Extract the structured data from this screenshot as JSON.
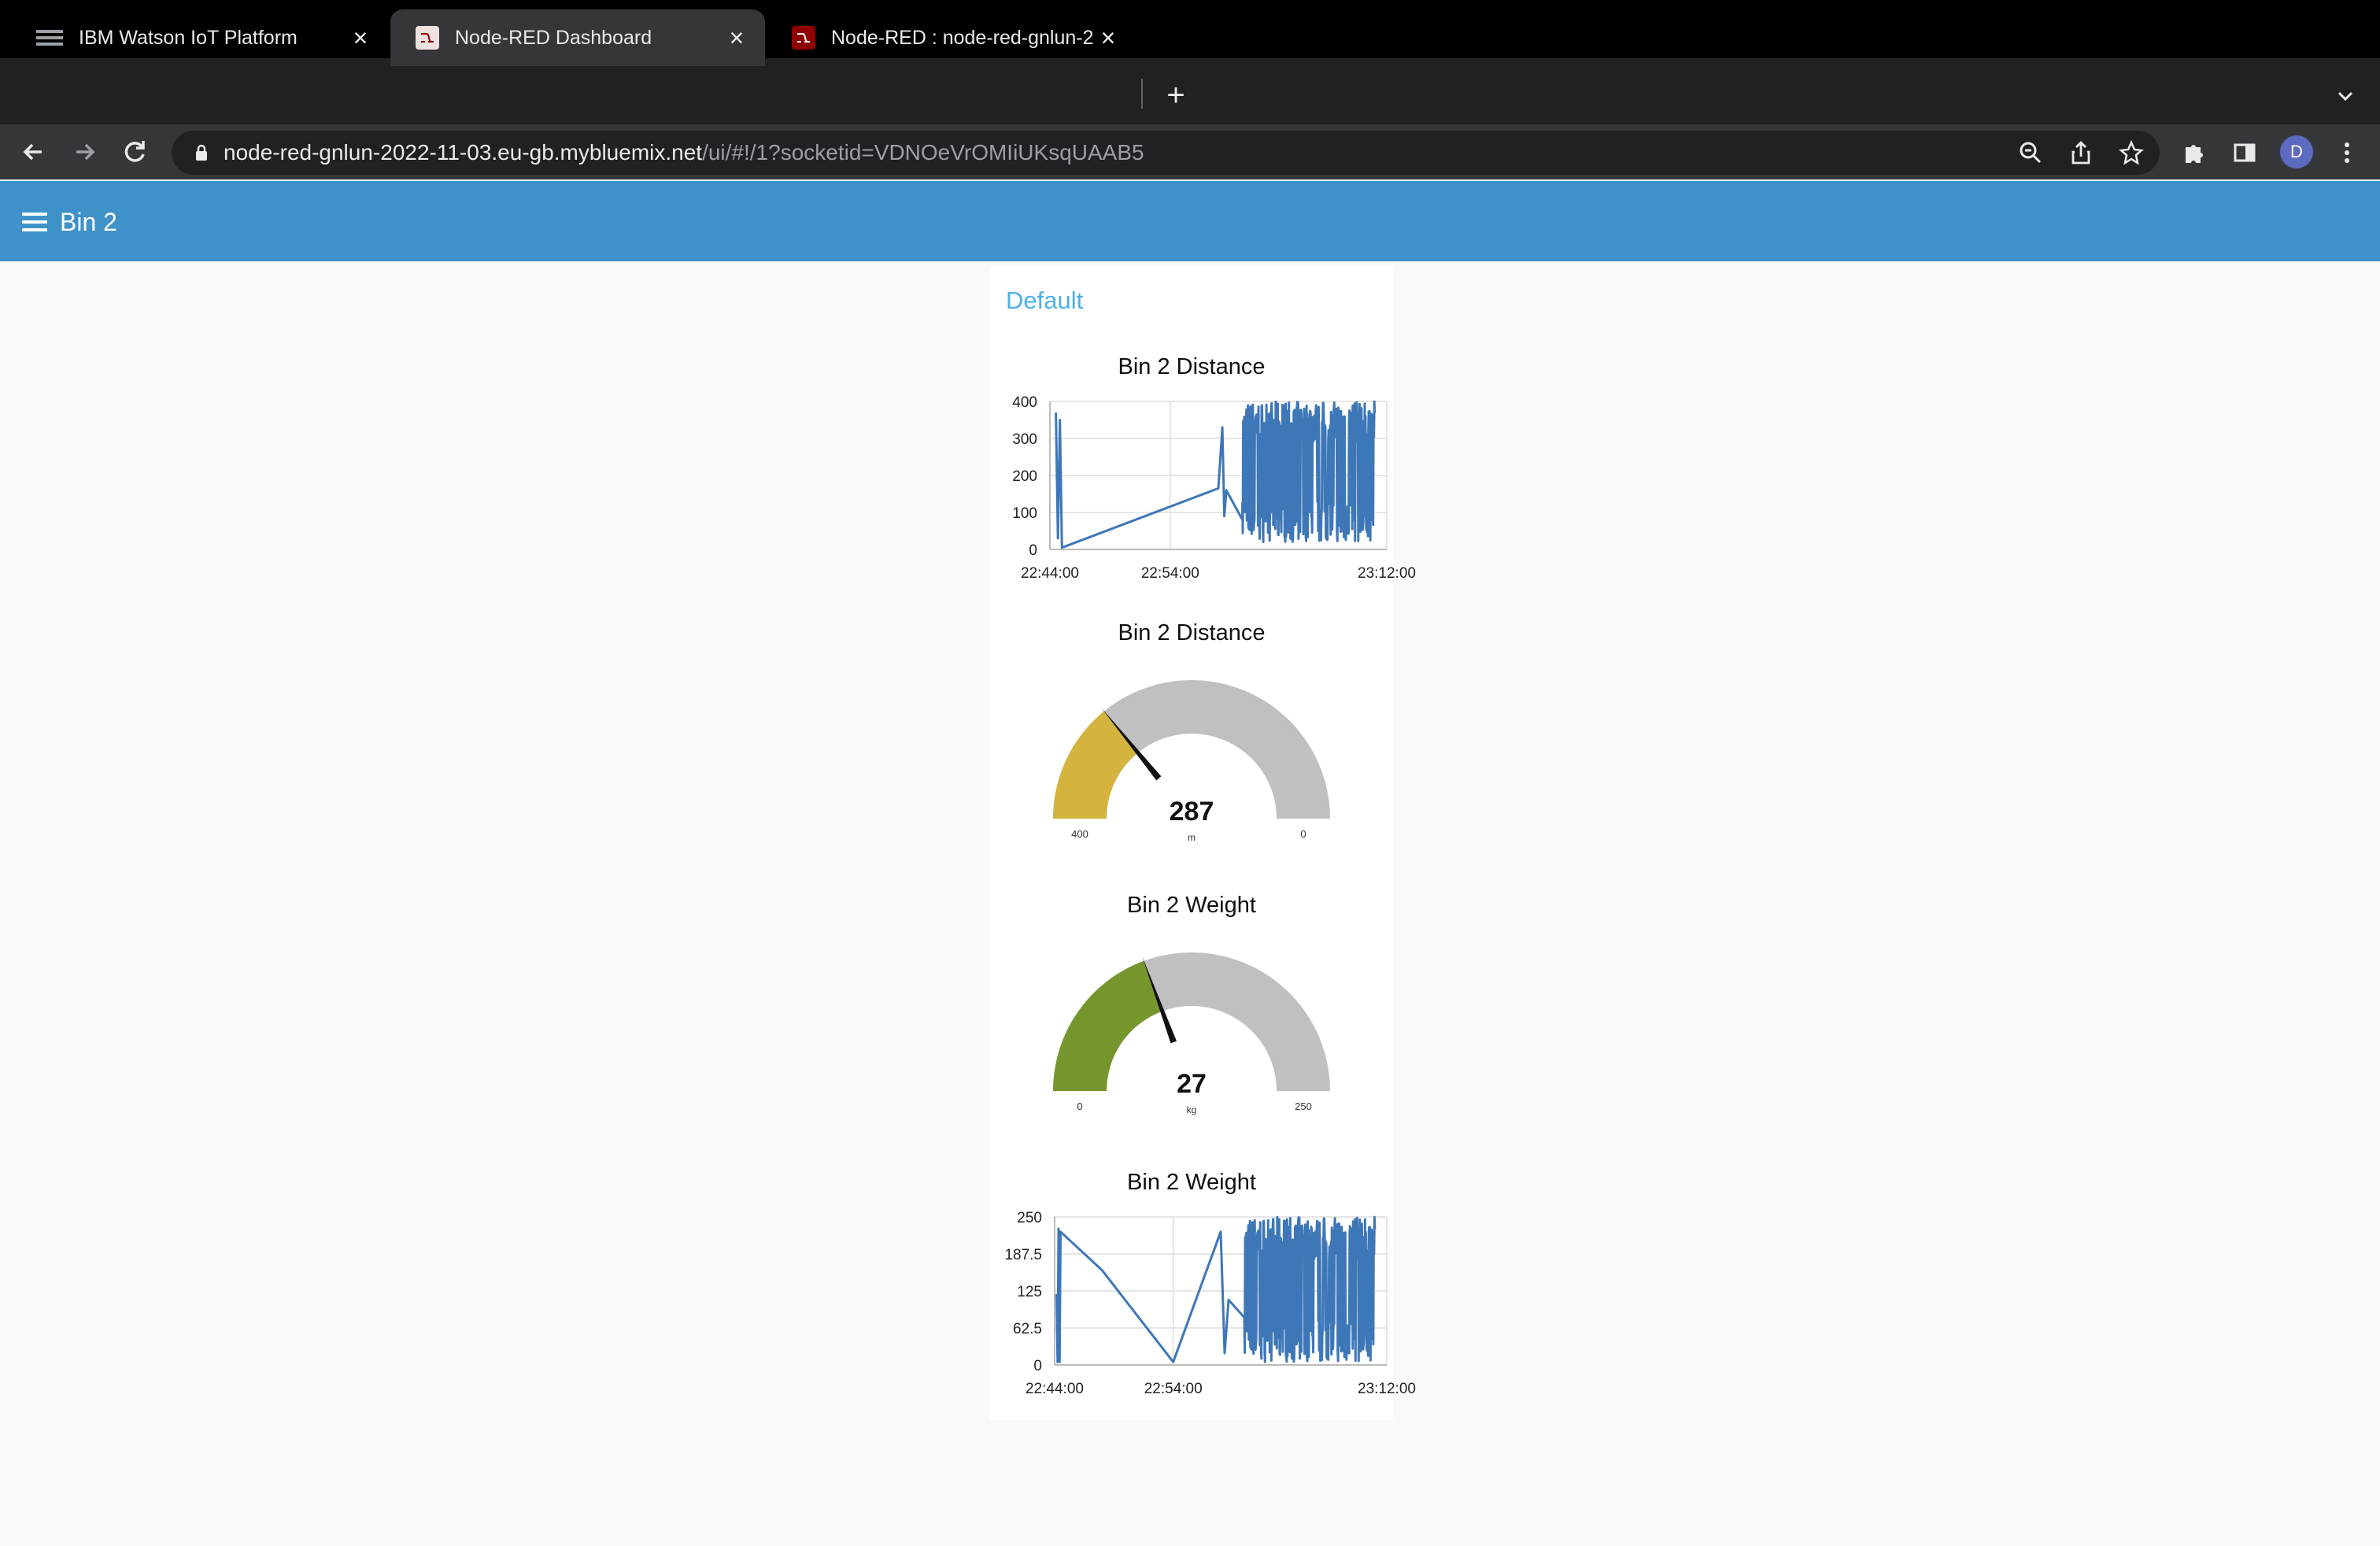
{
  "browser": {
    "tabs": [
      {
        "label": "IBM Watson IoT Platform",
        "active": false,
        "icon": "ibm-watson-icon"
      },
      {
        "label": "Node-RED Dashboard",
        "active": true,
        "icon": "node-red-icon"
      },
      {
        "label": "Node-RED : node-red-gnlun-2",
        "active": false,
        "icon": "node-red-icon"
      }
    ],
    "url_host": "node-red-gnlun-2022-11-03.eu-gb.mybluemix.net",
    "url_path": "/ui/#!/1?socketid=VDNOeVrOMIiUKsqUAAB5",
    "avatar_letter": "D"
  },
  "app": {
    "title": "Bin 2",
    "group_title": "Default",
    "accent_color": "#3f92c9"
  },
  "widgets": {
    "distance_chart_title": "Bin 2 Distance",
    "distance_gauge_title": "Bin 2 Distance",
    "weight_gauge_title": "Bin 2 Weight",
    "weight_chart_title": "Bin 2 Weight"
  },
  "gauges": {
    "distance": {
      "value": "287",
      "units": "m",
      "min_label": "400",
      "max_label": "0",
      "fraction": 0.2825,
      "color": "#d4b33e"
    },
    "weight": {
      "value": "27",
      "units": "kg",
      "min_label": "0",
      "max_label": "250",
      "fraction": 0.388,
      "color": "#74962d"
    }
  },
  "chart_data": [
    {
      "type": "line",
      "title": "Bin 2 Distance",
      "x_ticks": [
        "22:44:00",
        "22:54:00",
        "23:12:00"
      ],
      "y_ticks": [
        "0",
        "100",
        "200",
        "300",
        "400"
      ],
      "ylim": [
        0,
        400
      ],
      "xlim": [
        "22:44:00",
        "23:12:00"
      ],
      "series_color": "#3e77b8",
      "points": [
        [
          "22:44:30",
          370
        ],
        [
          "22:44:40",
          30
        ],
        [
          "22:44:50",
          350
        ],
        [
          "22:45:00",
          5
        ],
        [
          "22:58:00",
          165
        ],
        [
          "22:58:20",
          330
        ],
        [
          "22:58:30",
          90
        ],
        [
          "22:58:40",
          160
        ],
        [
          "23:00:00",
          80
        ]
      ],
      "noise_start": "23:00:00",
      "noise_end": "23:11:00",
      "noise_range": [
        20,
        400
      ]
    },
    {
      "type": "line",
      "title": "Bin 2 Weight",
      "x_ticks": [
        "22:44:00",
        "22:54:00",
        "23:12:00"
      ],
      "y_ticks": [
        "0",
        "62.5",
        "125",
        "187.5",
        "250"
      ],
      "ylim": [
        0,
        250
      ],
      "xlim": [
        "22:44:00",
        "23:12:00"
      ],
      "series_color": "#3e77b8",
      "points": [
        [
          "22:44:10",
          120
        ],
        [
          "22:44:15",
          5
        ],
        [
          "22:44:20",
          230
        ],
        [
          "22:44:25",
          5
        ],
        [
          "22:44:30",
          225
        ],
        [
          "22:48:00",
          160
        ],
        [
          "22:54:00",
          5
        ],
        [
          "22:58:00",
          225
        ],
        [
          "22:58:20",
          20
        ],
        [
          "22:58:40",
          110
        ],
        [
          "23:00:00",
          80
        ]
      ],
      "noise_start": "23:00:00",
      "noise_end": "23:11:00",
      "noise_range": [
        5,
        250
      ]
    }
  ]
}
